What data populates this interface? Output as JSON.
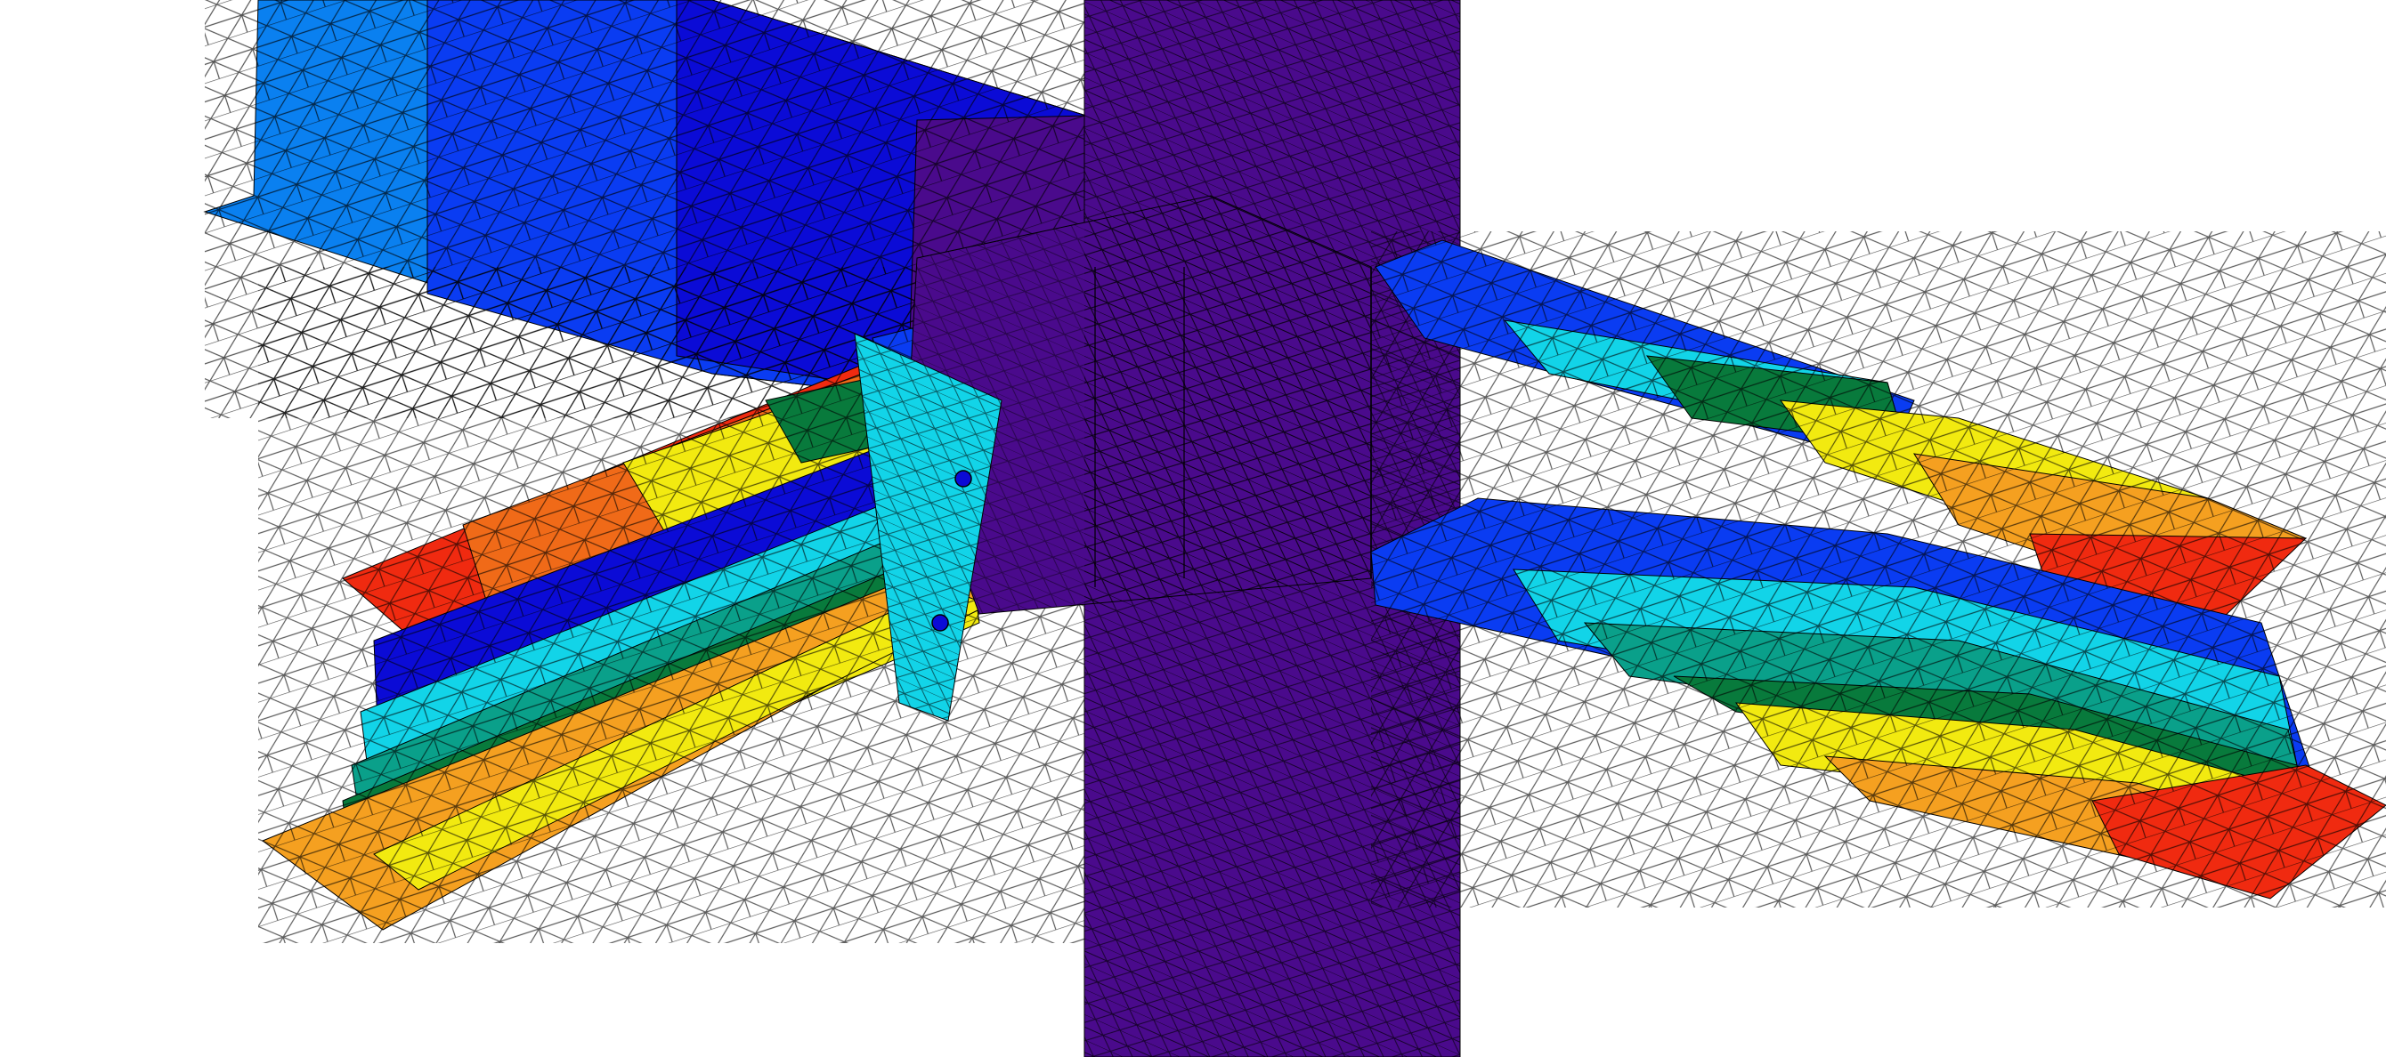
{
  "figure": {
    "kind": "finite-element stress contour render",
    "palette": {
      "violet": "#4a0a8c",
      "blue_dark": "#0b0bd6",
      "blue": "#0a3cf2",
      "blue_light": "#0a80f0",
      "cyan": "#12d4e8",
      "teal": "#0aa08a",
      "green_dark": "#087a3c",
      "lime": "#c0da1a",
      "yellow": "#f2ea10",
      "orange": "#f5a020",
      "orange_dark": "#f06a18",
      "red": "#f02a10",
      "mesh": "#000000",
      "background": "#ffffff"
    }
  }
}
